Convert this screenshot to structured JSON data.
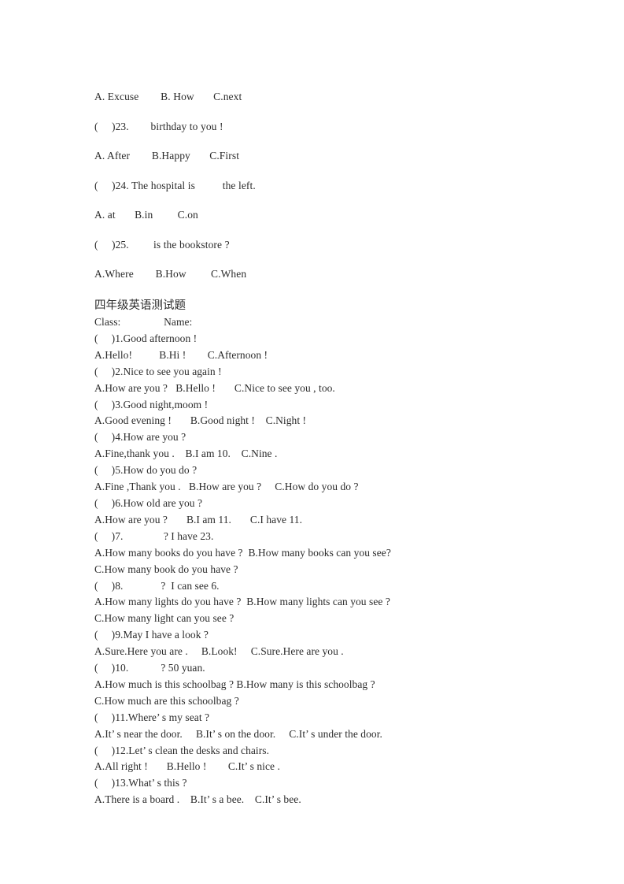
{
  "document": {
    "type": "exam-paper",
    "language": "zh-CN/en",
    "page_background": "#ffffff",
    "text_color": "#2b2b2b"
  },
  "section_prev": {
    "name": "carryover-questions-23-25",
    "lines": [
      "A. Excuse        B. How       C.next",
      "(     )23.        birthday to you !",
      "A. After        B.Happy       C.First",
      "(     )24. The hospital is          the left.",
      "A. at       B.in         C.on",
      "(     )25.         is the bookstore ?",
      "A.Where        B.How         C.When"
    ]
  },
  "section_main": {
    "name": "grade-4-english-test",
    "title": "四年级英语测试题",
    "info_line": "Class:                Name:",
    "lines": [
      "(     )1.Good afternoon !",
      "A.Hello!          B.Hi !        C.Afternoon !",
      "(     )2.Nice to see you again !",
      "A.How are you ?   B.Hello !       C.Nice to see you , too.",
      "(     )3.Good night,moom !",
      "A.Good evening !       B.Good night !    C.Night !",
      "(     )4.How are you ?",
      "A.Fine,thank you .    B.I am 10.    C.Nine .",
      "(     )5.How do you do ?",
      "A.Fine ,Thank you .   B.How are you ?     C.How do you do ?",
      "(     )6.How old are you ?",
      "A.How are you ?       B.I am 11.       C.I have 11.",
      "(     )7.               ? I have 23.",
      "A.How many books do you have ?  B.How many books can you see?",
      "C.How many book do you have ?",
      "(     )8.              ?  I can see 6.",
      "A.How many lights do you have ?  B.How many lights can you see ?",
      "C.How many light can you see ?",
      "(     )9.May I have a look ?",
      "A.Sure.Here you are .     B.Look!     C.Sure.Here are you .",
      "(     )10.            ? 50 yuan.",
      "A.How much is this schoolbag ? B.How many is this schoolbag ?",
      "C.How much are this schoolbag ?",
      "(     )11.Where’ s my seat ?",
      "A.It’ s near the door.     B.It’ s on the door.     C.It’ s under the door.",
      "(     )12.Let’ s clean the desks and chairs.",
      "A.All right !       B.Hello !        C.It’ s nice .",
      "(     )13.What’ s this ?",
      "A.There is a board .    B.It’ s a bee.    C.It’ s bee."
    ]
  }
}
